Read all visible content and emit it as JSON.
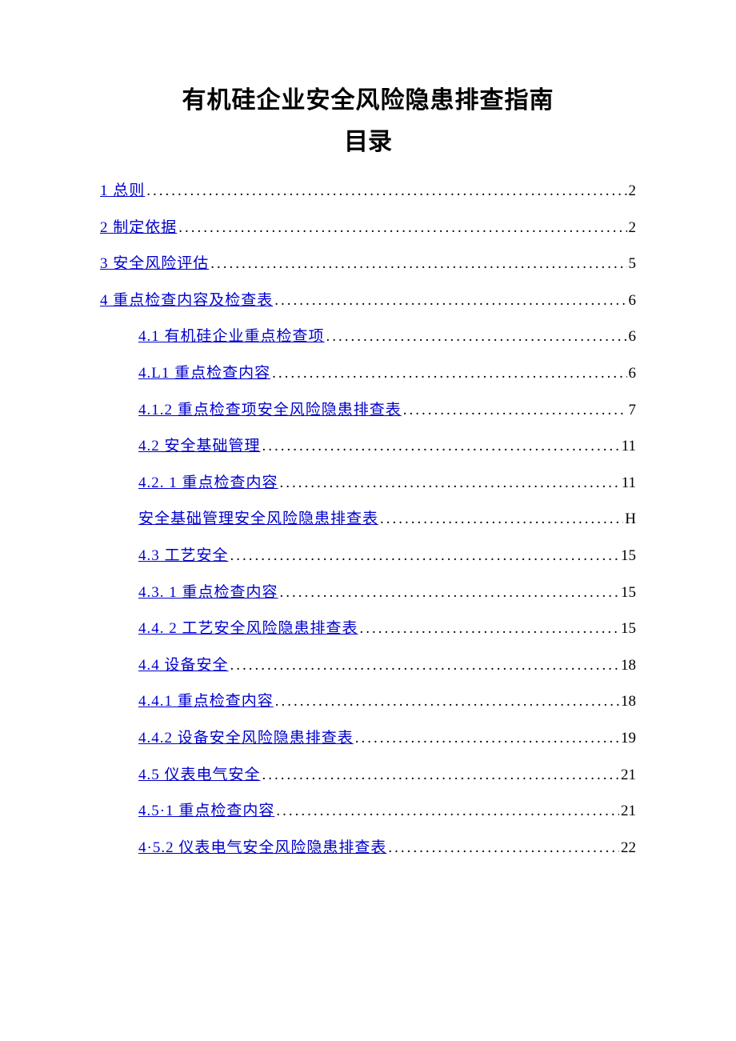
{
  "document": {
    "title": "有机硅企业安全风险隐患排查指南",
    "subtitle": "目录"
  },
  "toc": [
    {
      "label": "1 总则",
      "page": "2",
      "level": 0
    },
    {
      "label": "2 制定依据",
      "page": "2",
      "level": 0
    },
    {
      "label": "3 安全风险评估",
      "page": "5",
      "level": 0
    },
    {
      "label": "4 重点检查内容及检查表",
      "page": "6",
      "level": 0
    },
    {
      "label": "4.1 有机硅企业重点检查项",
      "page": "6",
      "level": 1
    },
    {
      "label": "4.L1 重点检查内容",
      "page": "6",
      "level": 1
    },
    {
      "label": "4.1.2 重点检查项安全风险隐患排查表",
      "page": "7",
      "level": 1
    },
    {
      "label": "4.2 安全基础管理",
      "page": "11",
      "level": 1
    },
    {
      "label": "4.2. 1 重点检查内容",
      "page": "11",
      "level": 1
    },
    {
      "label": "安全基础管理安全风险隐患排查表",
      "page": "H",
      "level": 1
    },
    {
      "label": "4.3 工艺安全",
      "page": "15",
      "level": 1
    },
    {
      "label": "4.3. 1 重点检查内容",
      "page": "15",
      "level": 1
    },
    {
      "label": "4.4. 2 工艺安全风险隐患排查表",
      "page": "15",
      "level": 1
    },
    {
      "label": "4.4 设备安全",
      "page": "18",
      "level": 1
    },
    {
      "label": "4.4.1 重点检查内容",
      "page": "18",
      "level": 1
    },
    {
      "label": "4.4.2 设备安全风险隐患排查表",
      "page": "19",
      "level": 1
    },
    {
      "label": "4.5 仪表电气安全",
      "page": "21",
      "level": 1
    },
    {
      "label": "4.5·1 重点检查内容",
      "page": "21",
      "level": 1
    },
    {
      "label": "4·5.2 仪表电气安全风险隐患排查表",
      "page": "22",
      "level": 1
    }
  ]
}
